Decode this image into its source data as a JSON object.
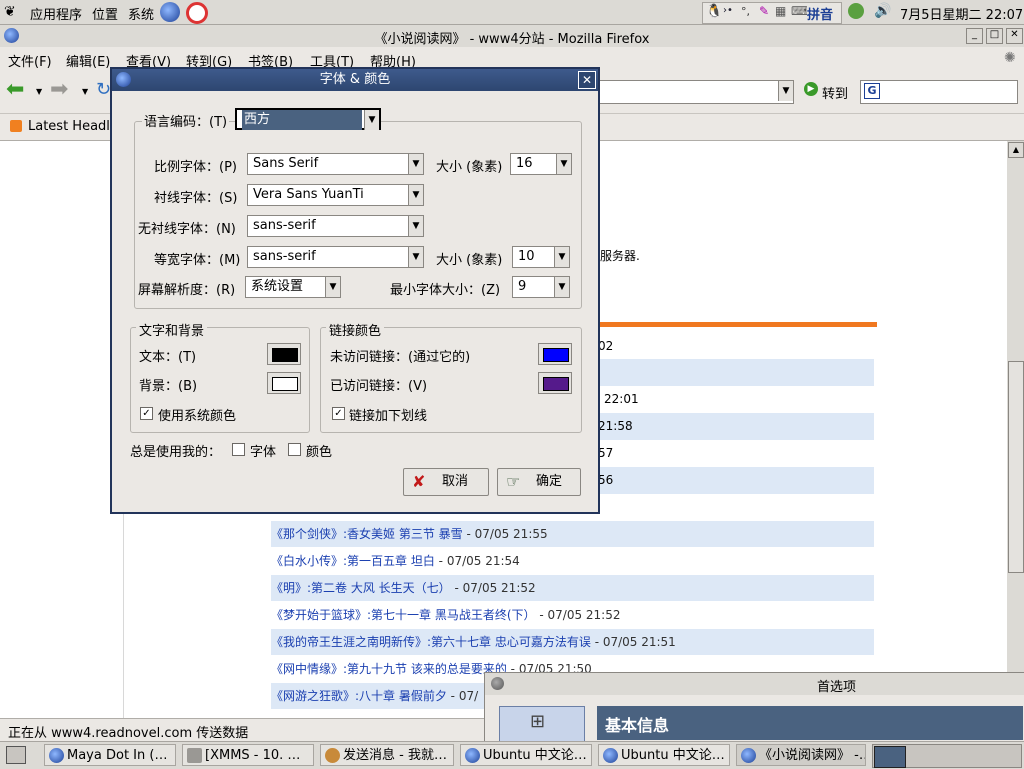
{
  "top_panel": {
    "menus": [
      "应用程序",
      "位置",
      "系统"
    ],
    "ime": "拼音",
    "clock": "7月5日星期二 22:07"
  },
  "firefox": {
    "title": "《小说阅读网》 - www4分站 - Mozilla Firefox",
    "menus": [
      "文件(F)",
      "编辑(E)",
      "查看(V)",
      "转到(G)",
      "书签(B)",
      "工具(T)",
      "帮助(H)"
    ],
    "go_label": "转到",
    "search_text": "G",
    "bookmark": "Latest Headl",
    "status": "正在从 www4.readnovel.com 传送数据",
    "partial_text": "服务器.",
    "partial_times": [
      "02",
      "22:01",
      "21:58",
      "57",
      "56"
    ]
  },
  "list": [
    {
      "link": "《那个剑侠》:香女美姬 第三节 暴雪",
      "time": " - 07/05 21:55",
      "alt": true
    },
    {
      "link": "《白水小传》:第一百五章 坦白",
      "time": " - 07/05 21:54",
      "alt": false
    },
    {
      "link": "《明》:第二卷 大风 长生天（七）",
      "time": " - 07/05 21:52",
      "alt": true
    },
    {
      "link": "《梦开始于篮球》:第七十一章 黑马战王者终(下）",
      "time": " - 07/05 21:52",
      "alt": false
    },
    {
      "link": "《我的帝王生涯之南明新传》:第六十七章 忠心可嘉方法有误",
      "time": " - 07/05 21:51",
      "alt": true
    },
    {
      "link": "《网中情缘》:第九十九节 该来的总是要来的",
      "time": " - 07/05 21:50",
      "alt": false
    },
    {
      "link": "《网游之狂歌》:八十章 暑假前夕",
      "time": " - 07/",
      "alt": true
    }
  ],
  "dialog": {
    "title": "字体 & 颜色",
    "encoding_label": "语言编码：(T)",
    "encoding_value": "西方",
    "proportional_label": "比例字体：(P)",
    "proportional_value": "Sans Serif",
    "size_label": "大小 (象素)",
    "size_value": "16",
    "serif_label": "衬线字体：(S)",
    "serif_value": "Vera Sans YuanTi",
    "sans_label": "无衬线字体：(N)",
    "sans_value": "sans-serif",
    "mono_label": "等宽字体：(M)",
    "mono_value": "sans-serif",
    "mono_size_label": "大小 (象素)",
    "mono_size_value": "10",
    "resolution_label": "屏幕解析度：(R)",
    "resolution_value": "系统设置",
    "min_size_label": "最小字体大小：(Z)",
    "min_size_value": "9",
    "text_bg_group": "文字和背景",
    "text_label": "文本：(T)",
    "text_color": "#000000",
    "bg_label": "背景：(B)",
    "bg_color": "#ffffff",
    "use_system_colors": "使用系统颜色",
    "link_group": "链接颜色",
    "unvisited_label": "未访问链接：(通过它的)",
    "unvisited_color": "#0000ff",
    "visited_label": "已访问链接：(V)",
    "visited_color": "#551a8b",
    "underline_links": "链接加下划线",
    "always_use": "总是使用我的：",
    "fonts_cb": "字体",
    "colors_cb": "颜色",
    "cancel": "取消",
    "ok": "确定"
  },
  "prefs": {
    "title": "首选项",
    "section": "基本信息"
  },
  "taskbar": [
    "Maya Dot In (…",
    "[XMMS - 10. …",
    "发送消息 - 我就…",
    "Ubuntu 中文论…",
    "Ubuntu 中文论…",
    "《小说阅读网》 -…"
  ],
  "colors": {
    "accent_orange": "#f07820",
    "link_blue": "#1a3fb0",
    "title_blue": "#2d4670"
  }
}
